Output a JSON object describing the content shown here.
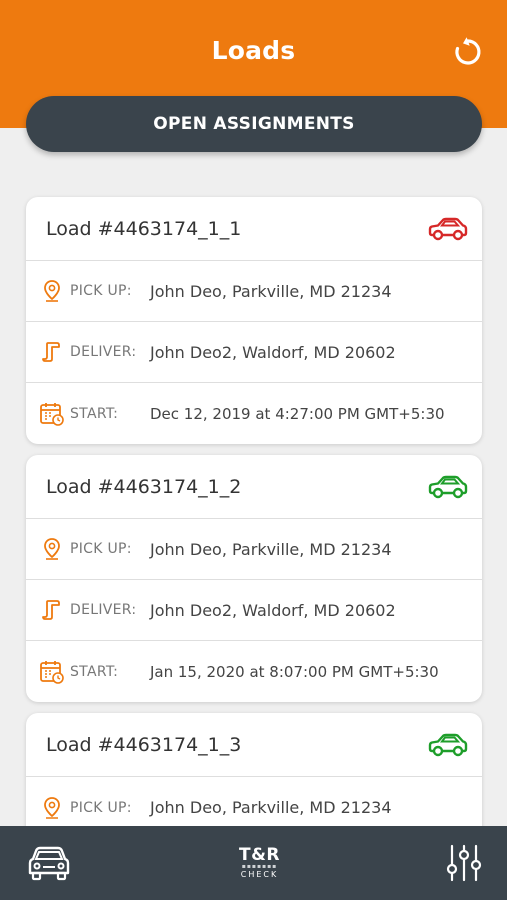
{
  "header": {
    "title": "Loads",
    "refresh_icon": "refresh-icon",
    "open_button_label": "OPEN ASSIGNMENTS",
    "accent_color": "#ee7a0f"
  },
  "loads": [
    {
      "title": "Load #4463174_1_1",
      "status_color": "#d62828",
      "pickup_label": "PICK UP:",
      "pickup": "John Deo, Parkville, MD 21234",
      "deliver_label": "DELIVER:",
      "deliver": "John Deo2, Waldorf, MD 20602",
      "start_label": "START:",
      "start": "Dec 12, 2019 at 4:27:00 PM GMT+5:30"
    },
    {
      "title": "Load #4463174_1_2",
      "status_color": "#1e9e2a",
      "pickup_label": "PICK UP:",
      "pickup": "John Deo, Parkville, MD 21234",
      "deliver_label": "DELIVER:",
      "deliver": "John Deo2, Waldorf, MD 20602",
      "start_label": "START:",
      "start": "Jan 15, 2020 at 8:07:00 PM GMT+5:30"
    },
    {
      "title": "Load #4463174_1_3",
      "status_color": "#1e9e2a",
      "pickup_label": "PICK UP:",
      "pickup": "John Deo, Parkville, MD 21234"
    }
  ],
  "tabbar": {
    "left_icon": "car-icon",
    "brand_top": "T&R",
    "brand_dots": "▪▪▪▪▪▪▪",
    "brand_bottom": "CHECK",
    "right_icon": "filter-sliders-icon"
  }
}
